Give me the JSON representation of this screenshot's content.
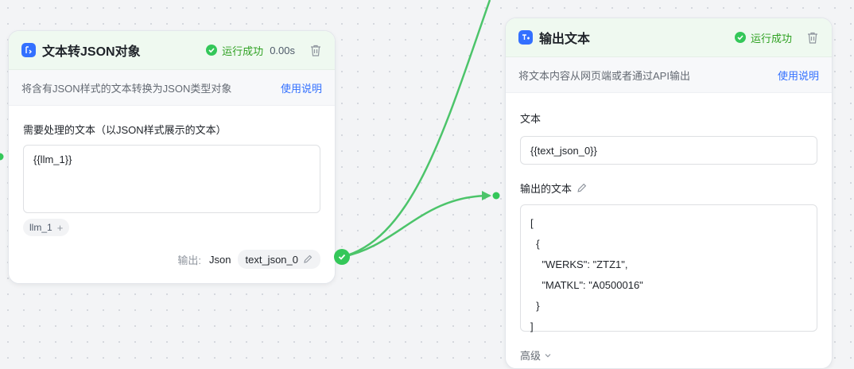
{
  "node_left": {
    "title": "文本转JSON对象",
    "status": "运行成功",
    "duration": "0.00s",
    "description": "将含有JSON样式的文本转换为JSON类型对象",
    "help_link": "使用说明",
    "input_label": "需要处理的文本（以JSON样式展示的文本）",
    "input_value": "{{llm_1}}",
    "variable_tag": "llm_1",
    "variable_add": "+",
    "output_label": "输出:",
    "output_type": "Json",
    "output_name": "text_json_0"
  },
  "node_right": {
    "title": "输出文本",
    "status": "运行成功",
    "description": "将文本内容从网页端或者通过API输出",
    "help_link": "使用说明",
    "text_label": "文本",
    "text_value": "{{text_json_0}}",
    "output_label": "输出的文本",
    "output_value": "[\n  {\n    \"WERKS\": \"ZTZ1\",\n    \"MATKL\": \"A0500016\"\n  }\n]",
    "advanced_label": "高级"
  },
  "colors": {
    "success": "#34c759",
    "link": "#3370ff",
    "edge": "#4cc46a"
  },
  "icons": {
    "left_node": "json-transform-icon",
    "right_node": "text-output-icon",
    "status": "check-circle-icon",
    "delete": "trash-icon",
    "edit": "pencil-icon",
    "advanced": "chevron-down-icon"
  }
}
